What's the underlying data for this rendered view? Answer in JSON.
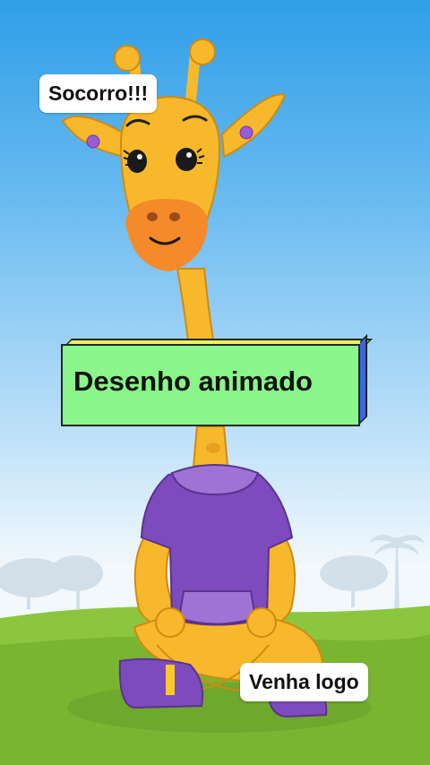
{
  "speech": {
    "top": "Socorro!!!",
    "bottom": "Venha logo"
  },
  "banner": {
    "title": "Desenho animado"
  },
  "colors": {
    "sky_top": "#2f9fe8",
    "grass": "#8cc63f",
    "giraffe": "#f7b92b",
    "shirt": "#7d4bbd",
    "banner_face": "#8af58a",
    "banner_top": "#f4ec5a",
    "banner_side": "#3d66e0"
  }
}
